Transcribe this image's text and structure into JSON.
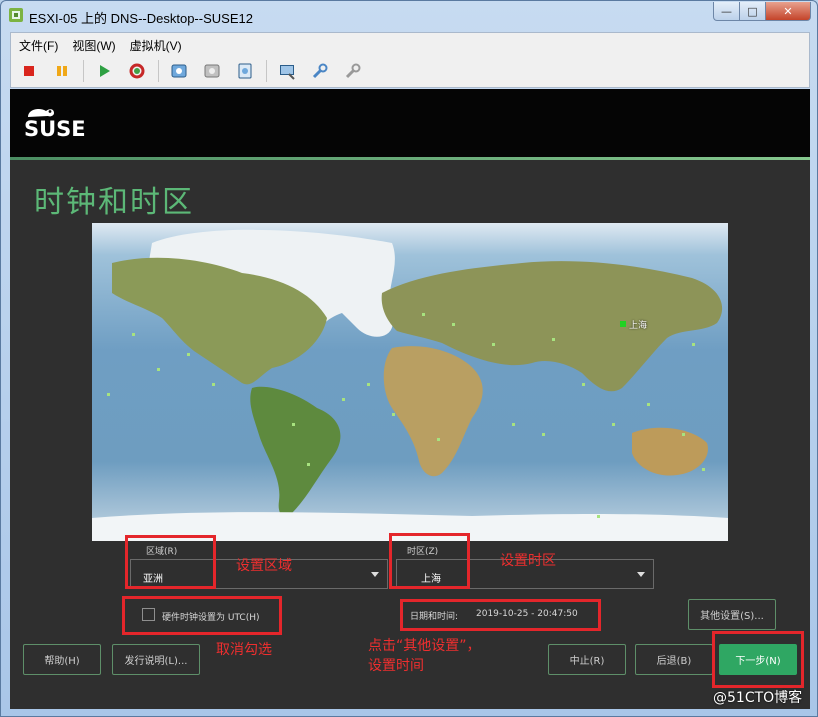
{
  "window": {
    "title": "ESXI-05 上的 DNS--Desktop--SUSE12",
    "min_glyph": "—",
    "max_glyph": "□",
    "close_glyph": "✕"
  },
  "menu": {
    "file": "文件(F)",
    "view": "视图(W)",
    "vm": "虚拟机(V)"
  },
  "toolbar_icons": [
    "stop-icon",
    "pause-icon",
    "play-icon",
    "reset-icon",
    "snapshot-icon",
    "snapshot-revert-icon",
    "snapshot-manager-icon",
    "console-icon",
    "settings-icon",
    "edit-settings-icon"
  ],
  "installer": {
    "logo_text": "SUSE",
    "heading": "时钟和时区",
    "city_label": "上海",
    "region_label": "区域(R)",
    "region_value": "亚洲",
    "timezone_label": "时区(Z)",
    "timezone_value": "上海",
    "utc_checkbox_label": "硬件时钟设置为 UTC(H)",
    "utc_checked": false,
    "datetime_label": "日期和时间:",
    "datetime_value": "2019-10-25 - 20:47:50",
    "other_settings_button": "其他设置(S)...",
    "help_button": "帮助(H)",
    "release_notes_button": "发行说明(L)...",
    "abort_button": "中止(R)",
    "back_button": "后退(B)",
    "next_button": "下一步(N)"
  },
  "annotations": {
    "set_region": "设置区域",
    "set_timezone": "设置时区",
    "uncheck": "取消勾选",
    "other_settings_line1": "点击“其他设置”，",
    "other_settings_line2": "设置时间"
  },
  "watermark": "@51CTO博客",
  "colors": {
    "accent_green": "#5cb877",
    "annotation_red": "#e4262b",
    "primary_button": "#2fa763"
  }
}
